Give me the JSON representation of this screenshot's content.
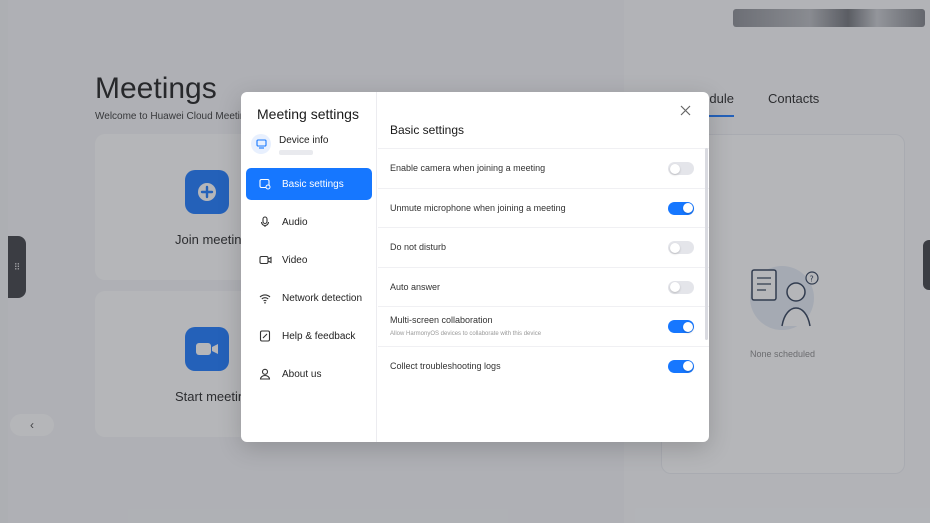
{
  "background": {
    "title": "Meetings",
    "subtitle": "Welcome to Huawei Cloud Meetin",
    "join_card_label": "Join meeting",
    "start_card_label": "Start meeting",
    "tabs": [
      {
        "label": "dule",
        "active": true
      },
      {
        "label": "Contacts",
        "active": false
      }
    ],
    "empty_state": "None scheduled"
  },
  "dialog": {
    "nav_title": "Meeting settings",
    "device_label": "Device info",
    "nav_items": [
      {
        "label": "Basic settings",
        "icon": "basic-settings-icon",
        "active": true
      },
      {
        "label": "Audio",
        "icon": "microphone-icon",
        "active": false
      },
      {
        "label": "Video",
        "icon": "video-camera-icon",
        "active": false
      },
      {
        "label": "Network detection",
        "icon": "wifi-icon",
        "active": false
      },
      {
        "label": "Help & feedback",
        "icon": "help-feedback-icon",
        "active": false
      },
      {
        "label": "About us",
        "icon": "person-icon",
        "active": false
      }
    ],
    "content_title": "Basic settings",
    "settings": [
      {
        "label": "Enable camera when joining a meeting",
        "sub": "",
        "on": false
      },
      {
        "label": "Unmute microphone when joining a meeting",
        "sub": "",
        "on": true
      },
      {
        "label": "Do not disturb",
        "sub": "",
        "on": false
      },
      {
        "label": "Auto answer",
        "sub": "",
        "on": false
      },
      {
        "label": "Multi-screen collaboration",
        "sub": "Allow HarmonyOS devices to collaborate with this device",
        "on": true
      },
      {
        "label": "Collect troubleshooting logs",
        "sub": "",
        "on": true
      }
    ]
  },
  "colors": {
    "accent": "#1677ff",
    "toggle_off": "#e4e5ea"
  }
}
